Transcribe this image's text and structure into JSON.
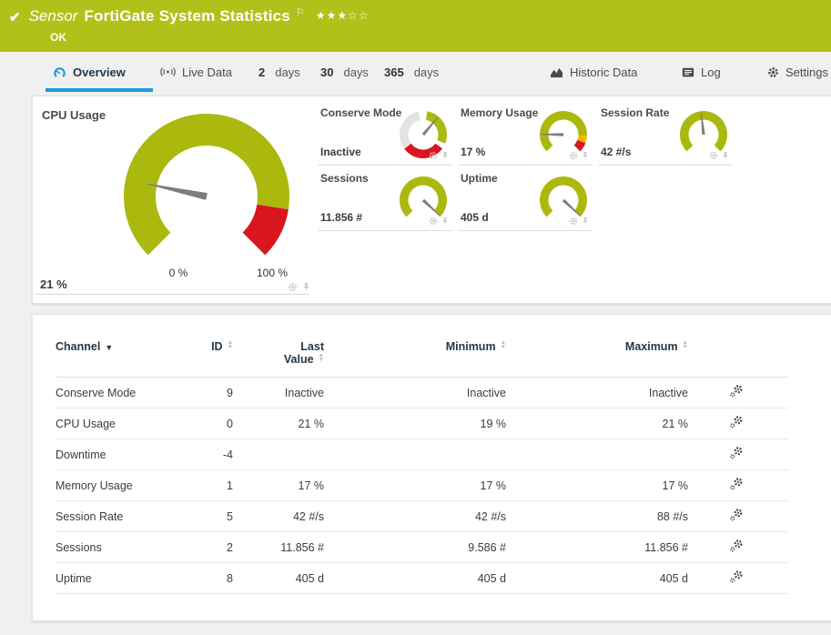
{
  "header": {
    "kind": "Sensor",
    "title": "FortiGate System Statistics",
    "status": "OK",
    "rating": {
      "filled": 3,
      "empty": 2
    }
  },
  "tabs": [
    {
      "label": "Overview",
      "icon": "gauge-icon",
      "active": true
    },
    {
      "label": "Live Data",
      "icon": "broadcast-icon"
    },
    {
      "num": "2",
      "unit": "days"
    },
    {
      "num": "30",
      "unit": "days"
    },
    {
      "num": "365",
      "unit": "days"
    },
    {
      "label": "Historic Data",
      "icon": "chart-icon"
    },
    {
      "label": "Log",
      "icon": "log-icon"
    },
    {
      "label": "Settings",
      "icon": "gear-icon"
    }
  ],
  "panels": {
    "cpu": {
      "title": "CPU Usage",
      "value": "21 %",
      "min_label": "0 %",
      "max_label": "100 %",
      "gauge": "cpu"
    },
    "small": [
      {
        "title": "Conserve Mode",
        "value": "Inactive",
        "gauge": "conserve"
      },
      {
        "title": "Memory Usage",
        "value": "17 %",
        "gauge": "memory"
      },
      {
        "title": "Session Rate",
        "value": "42 #/s",
        "gauge": "session_rate"
      },
      {
        "title": "Sessions",
        "value": "11.856 #",
        "gauge": "sessions"
      },
      {
        "title": "Uptime",
        "value": "405 d",
        "gauge": "uptime"
      }
    ]
  },
  "gauges": {
    "cpu": {
      "segments": [
        {
          "color": "green",
          "from": 225,
          "to": 459
        },
        {
          "color": "red",
          "from": 459,
          "to": 495
        }
      ],
      "needle": 282
    },
    "conserve": {
      "segments": [
        {
          "color": "grey",
          "from": 233,
          "to": 348
        },
        {
          "color": "green",
          "from": 370,
          "to": 472
        },
        {
          "color": "red",
          "from": 486,
          "to": 593
        }
      ],
      "needle": 40
    },
    "memory": {
      "segments": [
        {
          "color": "green",
          "from": 225,
          "to": 453
        },
        {
          "color": "yellow",
          "from": 453,
          "to": 471
        },
        {
          "color": "red",
          "from": 471,
          "to": 495
        }
      ],
      "needle": 271
    },
    "session_rate": {
      "segments": [
        {
          "color": "green",
          "from": 225,
          "to": 495
        }
      ],
      "needle": 354
    },
    "sessions": {
      "segments": [
        {
          "color": "green",
          "from": 225,
          "to": 495
        }
      ],
      "needle": 133
    },
    "uptime": {
      "segments": [
        {
          "color": "green",
          "from": 225,
          "to": 495
        }
      ],
      "needle": 133
    }
  },
  "table": {
    "columns": [
      {
        "label": "Channel",
        "sort": "active"
      },
      {
        "label": "ID",
        "sort": "both"
      },
      {
        "label": "Last",
        "label2": "Value",
        "sort": "both"
      },
      {
        "label": "Minimum",
        "sort": "both"
      },
      {
        "label": "Maximum",
        "sort": "both"
      }
    ],
    "rows": [
      [
        "Conserve Mode",
        "9",
        "Inactive",
        "Inactive",
        "Inactive"
      ],
      [
        "CPU Usage",
        "0",
        "21 %",
        "19 %",
        "21 %"
      ],
      [
        "Downtime",
        "-4",
        "",
        "",
        ""
      ],
      [
        "Memory Usage",
        "1",
        "17 %",
        "17 %",
        "17 %"
      ],
      [
        "Session Rate",
        "5",
        "42 #/s",
        "42 #/s",
        "88 #/s"
      ],
      [
        "Sessions",
        "2",
        "11.856 #",
        "9.586 #",
        "11.856 #"
      ],
      [
        "Uptime",
        "8",
        "405 d",
        "405 d",
        "405 d"
      ]
    ]
  },
  "colors": {
    "header_green": "#b2c119",
    "gauge_green": "#abb90f",
    "gauge_red": "#d9151f",
    "gauge_yellow": "#fbb400",
    "gauge_grey": "#e3e3e3",
    "needle": "#7d7d7d",
    "accent_blue": "#1d9bd7"
  }
}
